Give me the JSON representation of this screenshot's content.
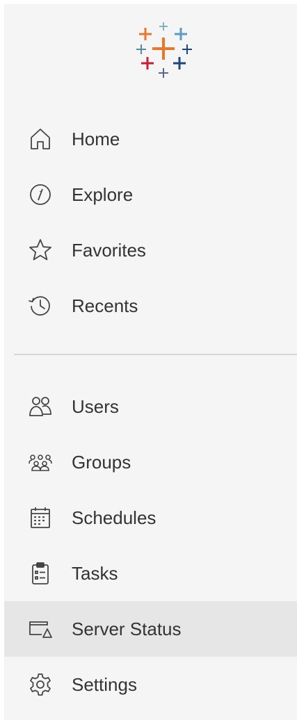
{
  "brand": {
    "logo_icon": "tableau-logo-icon"
  },
  "nav": {
    "primary": [
      {
        "label": "Home",
        "icon": "home-icon"
      },
      {
        "label": "Explore",
        "icon": "compass-icon"
      },
      {
        "label": "Favorites",
        "icon": "star-icon"
      },
      {
        "label": "Recents",
        "icon": "history-icon"
      }
    ],
    "admin": [
      {
        "label": "Users",
        "icon": "users-icon"
      },
      {
        "label": "Groups",
        "icon": "groups-icon"
      },
      {
        "label": "Schedules",
        "icon": "calendar-icon"
      },
      {
        "label": "Tasks",
        "icon": "clipboard-icon"
      },
      {
        "label": "Server Status",
        "icon": "server-status-icon",
        "active": true
      },
      {
        "label": "Settings",
        "icon": "gear-icon"
      }
    ]
  },
  "colors": {
    "sidebar_bg": "#f5f5f5",
    "active_bg": "#e6e6e6",
    "text": "#333333",
    "icon_stroke": "#444444",
    "divider": "#d6d6d6",
    "logo_orange": "#e8762b",
    "logo_blue_light": "#5b9bc8",
    "logo_teal": "#59879b",
    "logo_red": "#c72035",
    "logo_navy": "#1f457e",
    "logo_purple": "#5c6692"
  }
}
